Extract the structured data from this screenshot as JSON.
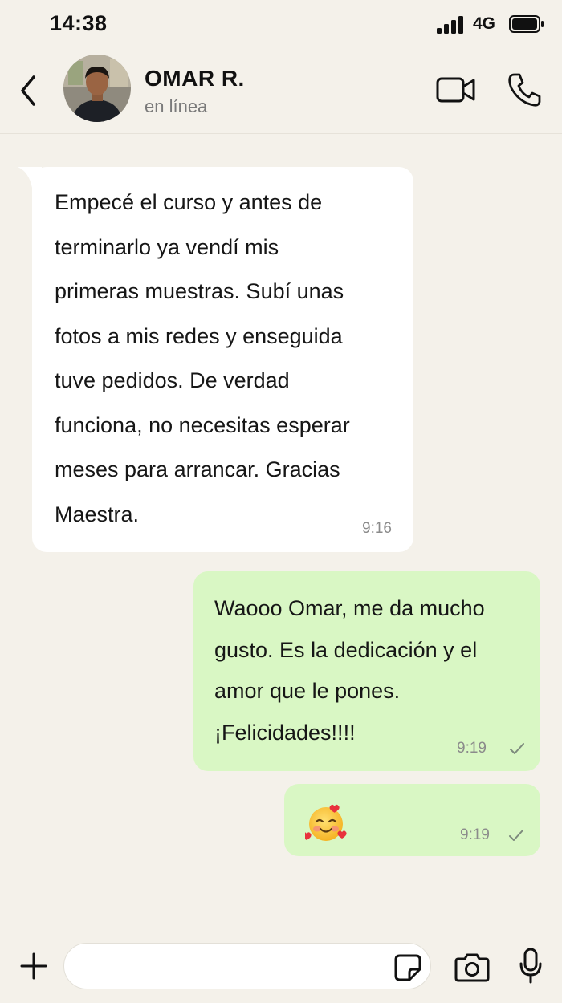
{
  "status_bar": {
    "time": "14:38",
    "network": "4G",
    "icons": [
      "signal-icon",
      "battery-icon"
    ]
  },
  "header": {
    "contact_name": "OMAR R.",
    "contact_status": "en línea",
    "icons": [
      "back-icon",
      "video-call-icon",
      "phone-call-icon"
    ]
  },
  "messages": [
    {
      "direction": "incoming",
      "lines": [
        "Empecé el curso y antes de",
        "terminarlo ya vendí mis",
        "primeras muestras. Subí unas",
        "fotos a mis redes y enseguida",
        "tuve pedidos. De verdad",
        "funciona, no necesitas esperar",
        "meses para arrancar. Gracias",
        "Maestra."
      ],
      "time": "9:16"
    },
    {
      "direction": "outgoing",
      "lines": [
        "Waooo Omar, me da mucho",
        "gusto. Es la dedicación y el",
        "amor que le pones.",
        "¡Felicidades!!!!"
      ],
      "time": "9:19",
      "status": "sent"
    },
    {
      "direction": "outgoing",
      "emoji": "smiling-face-with-hearts-emoji",
      "time": "9:19",
      "status": "sent"
    }
  ],
  "composer": {
    "placeholder": "",
    "icons": [
      "plus-icon",
      "sticker-icon",
      "camera-icon",
      "microphone-icon"
    ]
  },
  "colors": {
    "background": "#f4f1ea",
    "incoming_bubble": "#ffffff",
    "outgoing_bubble": "#d9f7c4",
    "muted_text": "#8b8b8b"
  }
}
